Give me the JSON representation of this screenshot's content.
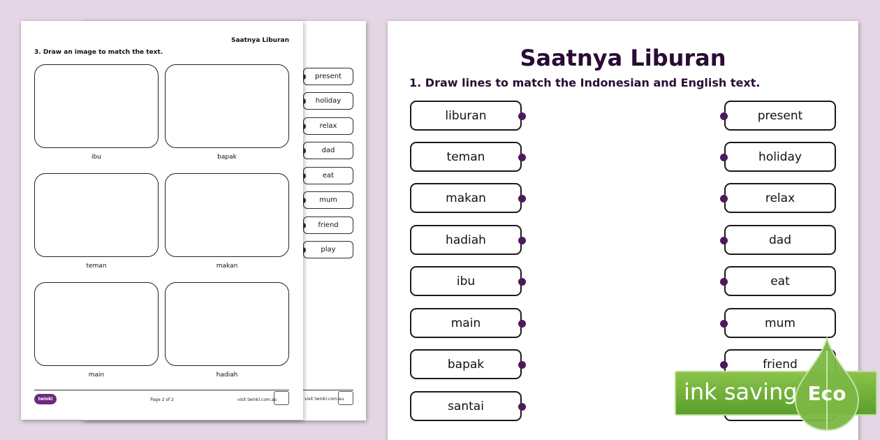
{
  "back_sheet": {
    "english_words": [
      "present",
      "holiday",
      "relax",
      "dad",
      "eat",
      "mum",
      "friend",
      "play"
    ],
    "footer_url": "visit twinkl.com.au"
  },
  "front_sheet": {
    "title": "Saatnya Liburan",
    "instruction": "3. Draw an image to match the text.",
    "boxes": [
      "ibu",
      "bapak",
      "teman",
      "makan",
      "main",
      "hadiah"
    ],
    "logo_text": "twinkl",
    "page_label": "Page 2 of 2",
    "footer_url": "visit twinkl.com.au"
  },
  "main_sheet": {
    "title": "Saatnya Liburan",
    "instruction": "1. Draw lines to match the Indonesian and English text.",
    "indonesian": [
      "liburan",
      "teman",
      "makan",
      "hadiah",
      "ibu",
      "main",
      "bapak",
      "santai"
    ],
    "english": [
      "present",
      "holiday",
      "relax",
      "dad",
      "eat",
      "mum",
      "friend"
    ]
  },
  "badge": {
    "text": "ink saving",
    "eco": "Eco",
    "color": "#8bc34a"
  }
}
